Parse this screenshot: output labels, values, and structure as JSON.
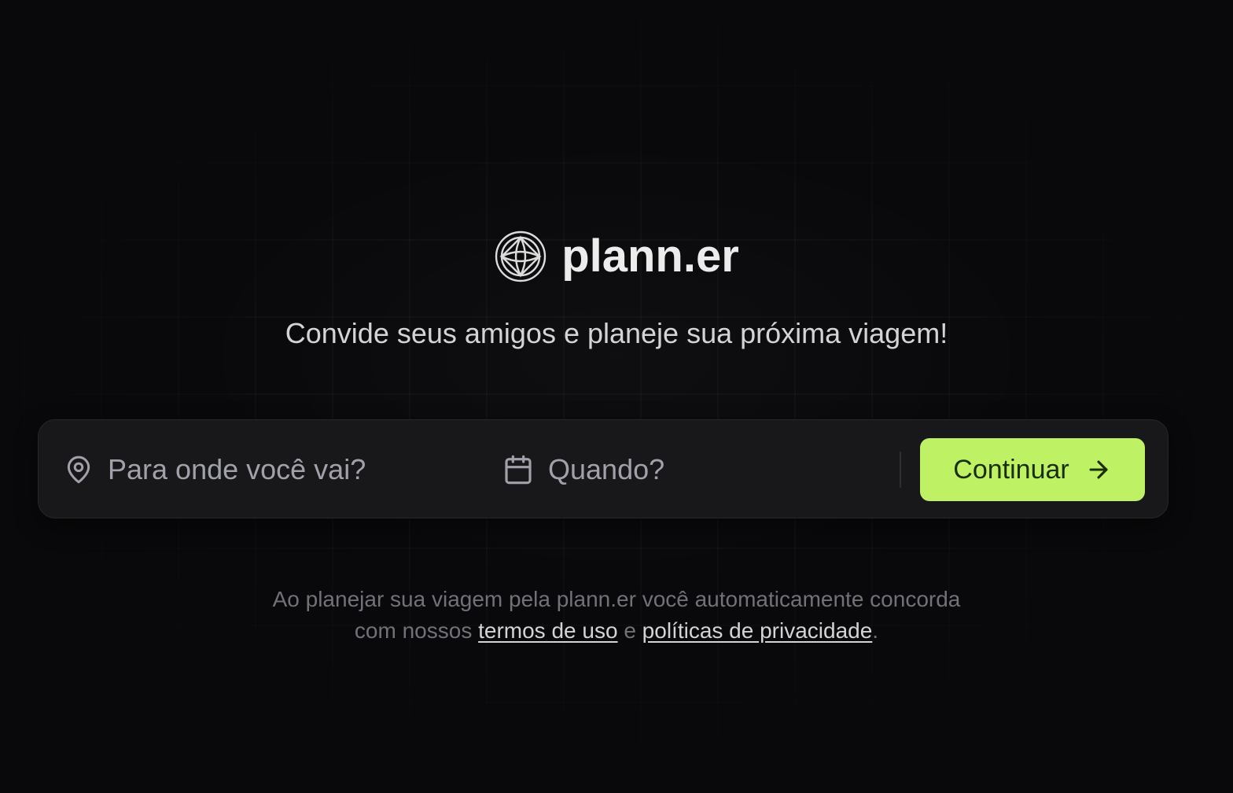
{
  "app": {
    "brand_name": "plann.er",
    "tagline": "Convide seus amigos e planeje sua próxima viagem!"
  },
  "search": {
    "destination_placeholder": "Para onde você vai?",
    "destination_icon": "map-pin-icon",
    "date_placeholder": "Quando?",
    "date_icon": "calendar-icon",
    "continue_label": "Continuar",
    "continue_icon": "arrow-right-icon"
  },
  "legal": {
    "line1": "Ao planejar sua viagem pela plann.er você automaticamente concorda",
    "line2_prefix": "com nossos",
    "terms_link": "termos de uso",
    "conjunction": "e",
    "privacy_link": "políticas de privacidade",
    "end_punctuation": "."
  },
  "colors": {
    "background": "#09090b",
    "surface": "#18181b",
    "accent": "#bef264",
    "accent_text": "#1a2e05",
    "muted_text": "#71717a",
    "placeholder_text": "#a1a1aa"
  }
}
